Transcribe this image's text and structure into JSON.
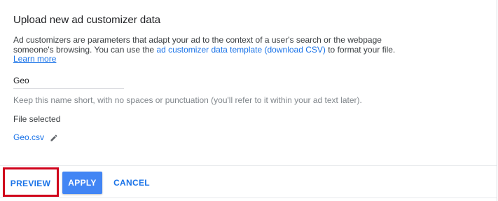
{
  "dialog": {
    "title": "Upload new ad customizer data",
    "description_line1": "Ad customizers are parameters that adapt your ad to the context of a user's search or the webpage",
    "description_line2_prefix": "someone's browsing. You can use the ",
    "template_link": "ad customizer data template (download CSV)",
    "description_line2_suffix": " to format your file.",
    "learn_more": "Learn more"
  },
  "name_field": {
    "value": "Geo",
    "hint": "Keep this name short, with no spaces or punctuation (you'll refer to it within your ad text later)."
  },
  "file": {
    "label": "File selected",
    "name": "Geo.csv",
    "edit_icon": "pencil-icon"
  },
  "actions": {
    "preview": "PREVIEW",
    "apply": "APPLY",
    "cancel": "CANCEL"
  },
  "colors": {
    "link": "#1a73e8",
    "primary_button": "#4285f4",
    "highlight": "#d0021b"
  }
}
